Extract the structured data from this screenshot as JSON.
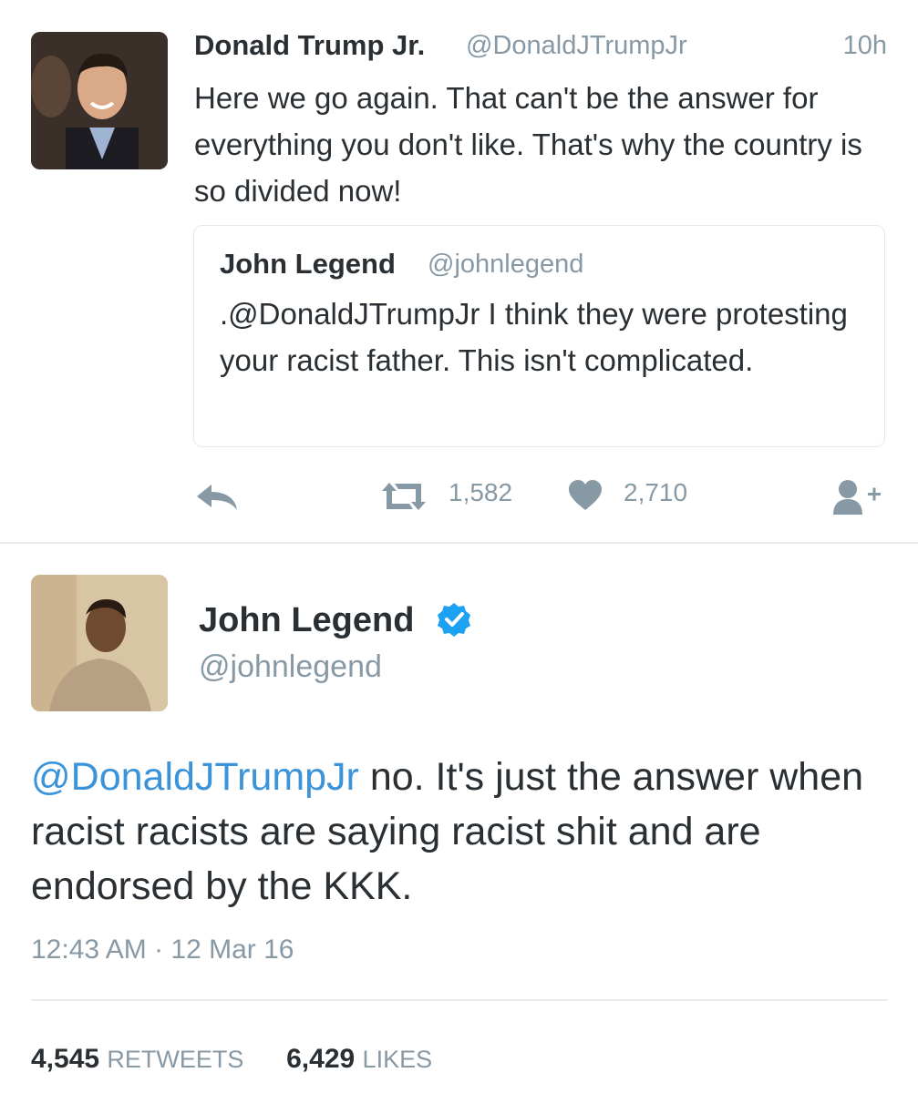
{
  "first_tweet": {
    "author_name": "Donald Trump Jr.",
    "author_handle": "@DonaldJTrumpJr",
    "time": "10h",
    "text": "Here we go again. That can't be the answer for everything you don't like. That's why the country is so divided now!",
    "quoted_tweet": {
      "author_name": "John Legend",
      "author_handle": "@johnlegend",
      "text": ".@DonaldJTrumpJr I think they were protesting your racist father. This isn't complicated."
    },
    "actions": {
      "reply_icon": "reply-icon",
      "retweet_icon": "retweet-icon",
      "retweet_count": "1,582",
      "like_icon": "heart-icon",
      "like_count": "2,710",
      "follow_icon": "follow-user-icon"
    }
  },
  "second_tweet": {
    "author_name": "John Legend",
    "verified_icon": "verified-badge-icon",
    "author_handle": "@johnlegend",
    "mention": "@DonaldJTrumpJr",
    "text": " no. It's just the answer when racist racists are saying racist shit and are endorsed by the KKK.",
    "timestamp": "12:43 AM · 12 Mar 16",
    "retweets_count": "4,545",
    "retweets_label": "RETWEETS",
    "likes_count": "6,429",
    "likes_label": "LIKES"
  },
  "colors": {
    "text": "#292f33",
    "muted": "#8899a6",
    "link": "#3b94d9",
    "verified": "#1da1f2",
    "divider": "#e6ecf0"
  }
}
